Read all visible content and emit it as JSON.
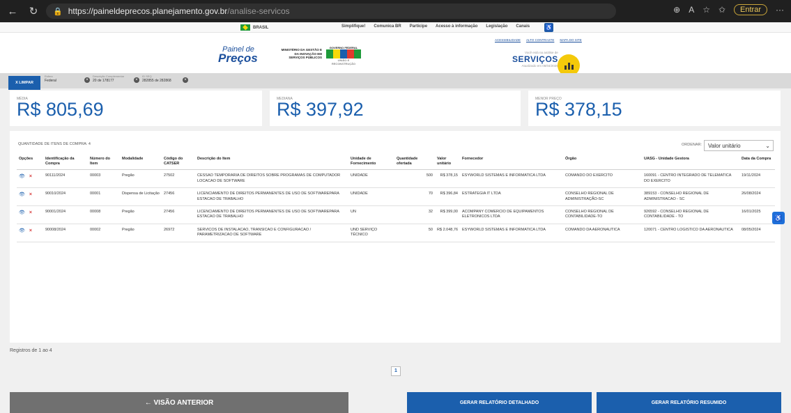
{
  "browser": {
    "url_host": "https://paineldeprecos.planejamento.gov.br",
    "url_path": "/analise-servicos",
    "entrar": "Entrar"
  },
  "govbar": {
    "brasil": "BRASIL",
    "links": [
      "Simplifique!",
      "Comunica BR",
      "Participe",
      "Acesso à informação",
      "Legislação",
      "Canais"
    ]
  },
  "header": {
    "logo_small": "Painel de",
    "logo_big": "Preços",
    "ministerio": "MINISTÉRIO DA GESTÃO E DA INOVAÇÃO EM SERVIÇOS PÚBLICOS",
    "gov_federal": "GOVERNO FEDERAL",
    "brasil_word": "BRASIL",
    "brasil_sub": "UNIÃO E RECONSTRUÇÃO",
    "top_links": [
      "ACESSIBILIDADE",
      "ALTO CONTRASTE",
      "MAPA DO SITE"
    ],
    "servicos_caption": "Você está na análise de",
    "servicos": "SERVIÇOS",
    "atualizado": "Atualizado em 08/04/2025"
  },
  "filters": {
    "limpar": "X LIMPAR",
    "chips": [
      {
        "label": "Esfera",
        "value": "Federal"
      },
      {
        "label": "Descrição Complementar",
        "value": "20 de 178177"
      },
      {
        "label": "ID SEQ",
        "value": "282855 de 282868"
      }
    ]
  },
  "stats": {
    "media_label": "MÉDIA",
    "media": "R$ 805,69",
    "mediana_label": "MEDIANA",
    "mediana": "R$ 397,92",
    "menor_label": "MENOR PREÇO",
    "menor": "R$ 378,15"
  },
  "table": {
    "quantidade": "QUANTIDADE DE ITENS DE COMPRA: 4",
    "ordenar_label": "ORDENAR:",
    "ordenar_value": "Valor unitário",
    "headers": [
      "Opções",
      "Identificação da Compra",
      "Número do Item",
      "Modalidade",
      "Código do CATSER",
      "Descrição do Item",
      "Unidade de Fornecimento",
      "Quantidade ofertada",
      "Valor unitário",
      "Fornecedor",
      "Órgão",
      "UASG - Unidade Gestora",
      "Data da Compra"
    ],
    "rows": [
      {
        "compra": "90111/2024",
        "item": "00003",
        "modalidade": "Pregão",
        "catser": "27502",
        "descricao": "CESSAO TEMPORARIA DE DIREITOS SOBRE PROGRAMAS DE COMPUTADOR LOCACAO DE SOFTWARE",
        "unidade": "UNIDADE",
        "qtd": "500",
        "valor": "R$ 378,15",
        "fornecedor": "ESYWORLD SISTEMAS E INFORMATICA LTDA",
        "orgao": "COMANDO DO EXERCITO",
        "uasg": "160091 - CENTRO INTEGRADO DE TELEMATICA DO EXERCITO",
        "data": "19/11/2024"
      },
      {
        "compra": "90010/2024",
        "item": "00001",
        "modalidade": "Dispensa de Licitação",
        "catser": "27456",
        "descricao": "LICENCIAMENTO DE DIREITOS PERMANENTES DE USO DE SOFTWAREPARA ESTACAO DE TRABALHO",
        "unidade": "UNIDADE",
        "qtd": "70",
        "valor": "R$ 396,84",
        "fornecedor": "ESTRATEGIA IT LTDA",
        "orgao": "CONSELHO REGIONAL DE ADMINISTRAÇÃO-SC",
        "uasg": "389153 - CONSELHO REGIONAL DE ADMINISTRACAO - SC",
        "data": "26/08/2024"
      },
      {
        "compra": "90001/2024",
        "item": "00008",
        "modalidade": "Pregão",
        "catser": "27456",
        "descricao": "LICENCIAMENTO DE DIREITOS PERMANENTES DE USO DE SOFTWAREPARA ESTACAO DE TRABALHO",
        "unidade": "UN",
        "qtd": "32",
        "valor": "R$ 399,00",
        "fornecedor": "ACOMPANY COMERCIO DE EQUIPAMENTOS ELETRONICOS LTDA",
        "orgao": "CONSELHO REGIONAL DE CONTABILIDADE-TO",
        "uasg": "926592 - CONSELHO REGIONAL DE CONTABILIDADE - TO",
        "data": "16/01/2025"
      },
      {
        "compra": "90008/2024",
        "item": "00002",
        "modalidade": "Pregão",
        "catser": "26972",
        "descricao": "SERVICOS DE INSTALACAO, TRANSICAO E CONFIGURACAO / PARAMETRIZACAO DE SOFTWARE",
        "unidade": "UND SERVIÇO TÉCNICO",
        "qtd": "50",
        "valor": "R$ 2.048,76",
        "fornecedor": "ESYWORLD SISTEMAS E INFORMATICA LTDA",
        "orgao": "COMANDO DA AERONAUTICA",
        "uasg": "120071 - CENTRO LOGISTICO DA AERONAUTICA",
        "data": "08/05/2024"
      }
    ]
  },
  "footer": {
    "registros": "Registros de 1 ao 4",
    "page": "1",
    "anterior": "←  VISÃO ANTERIOR",
    "detalhado": "GERAR RELATÓRIO DETALHADO",
    "resumido": "GERAR RELATÓRIO RESUMIDO"
  }
}
